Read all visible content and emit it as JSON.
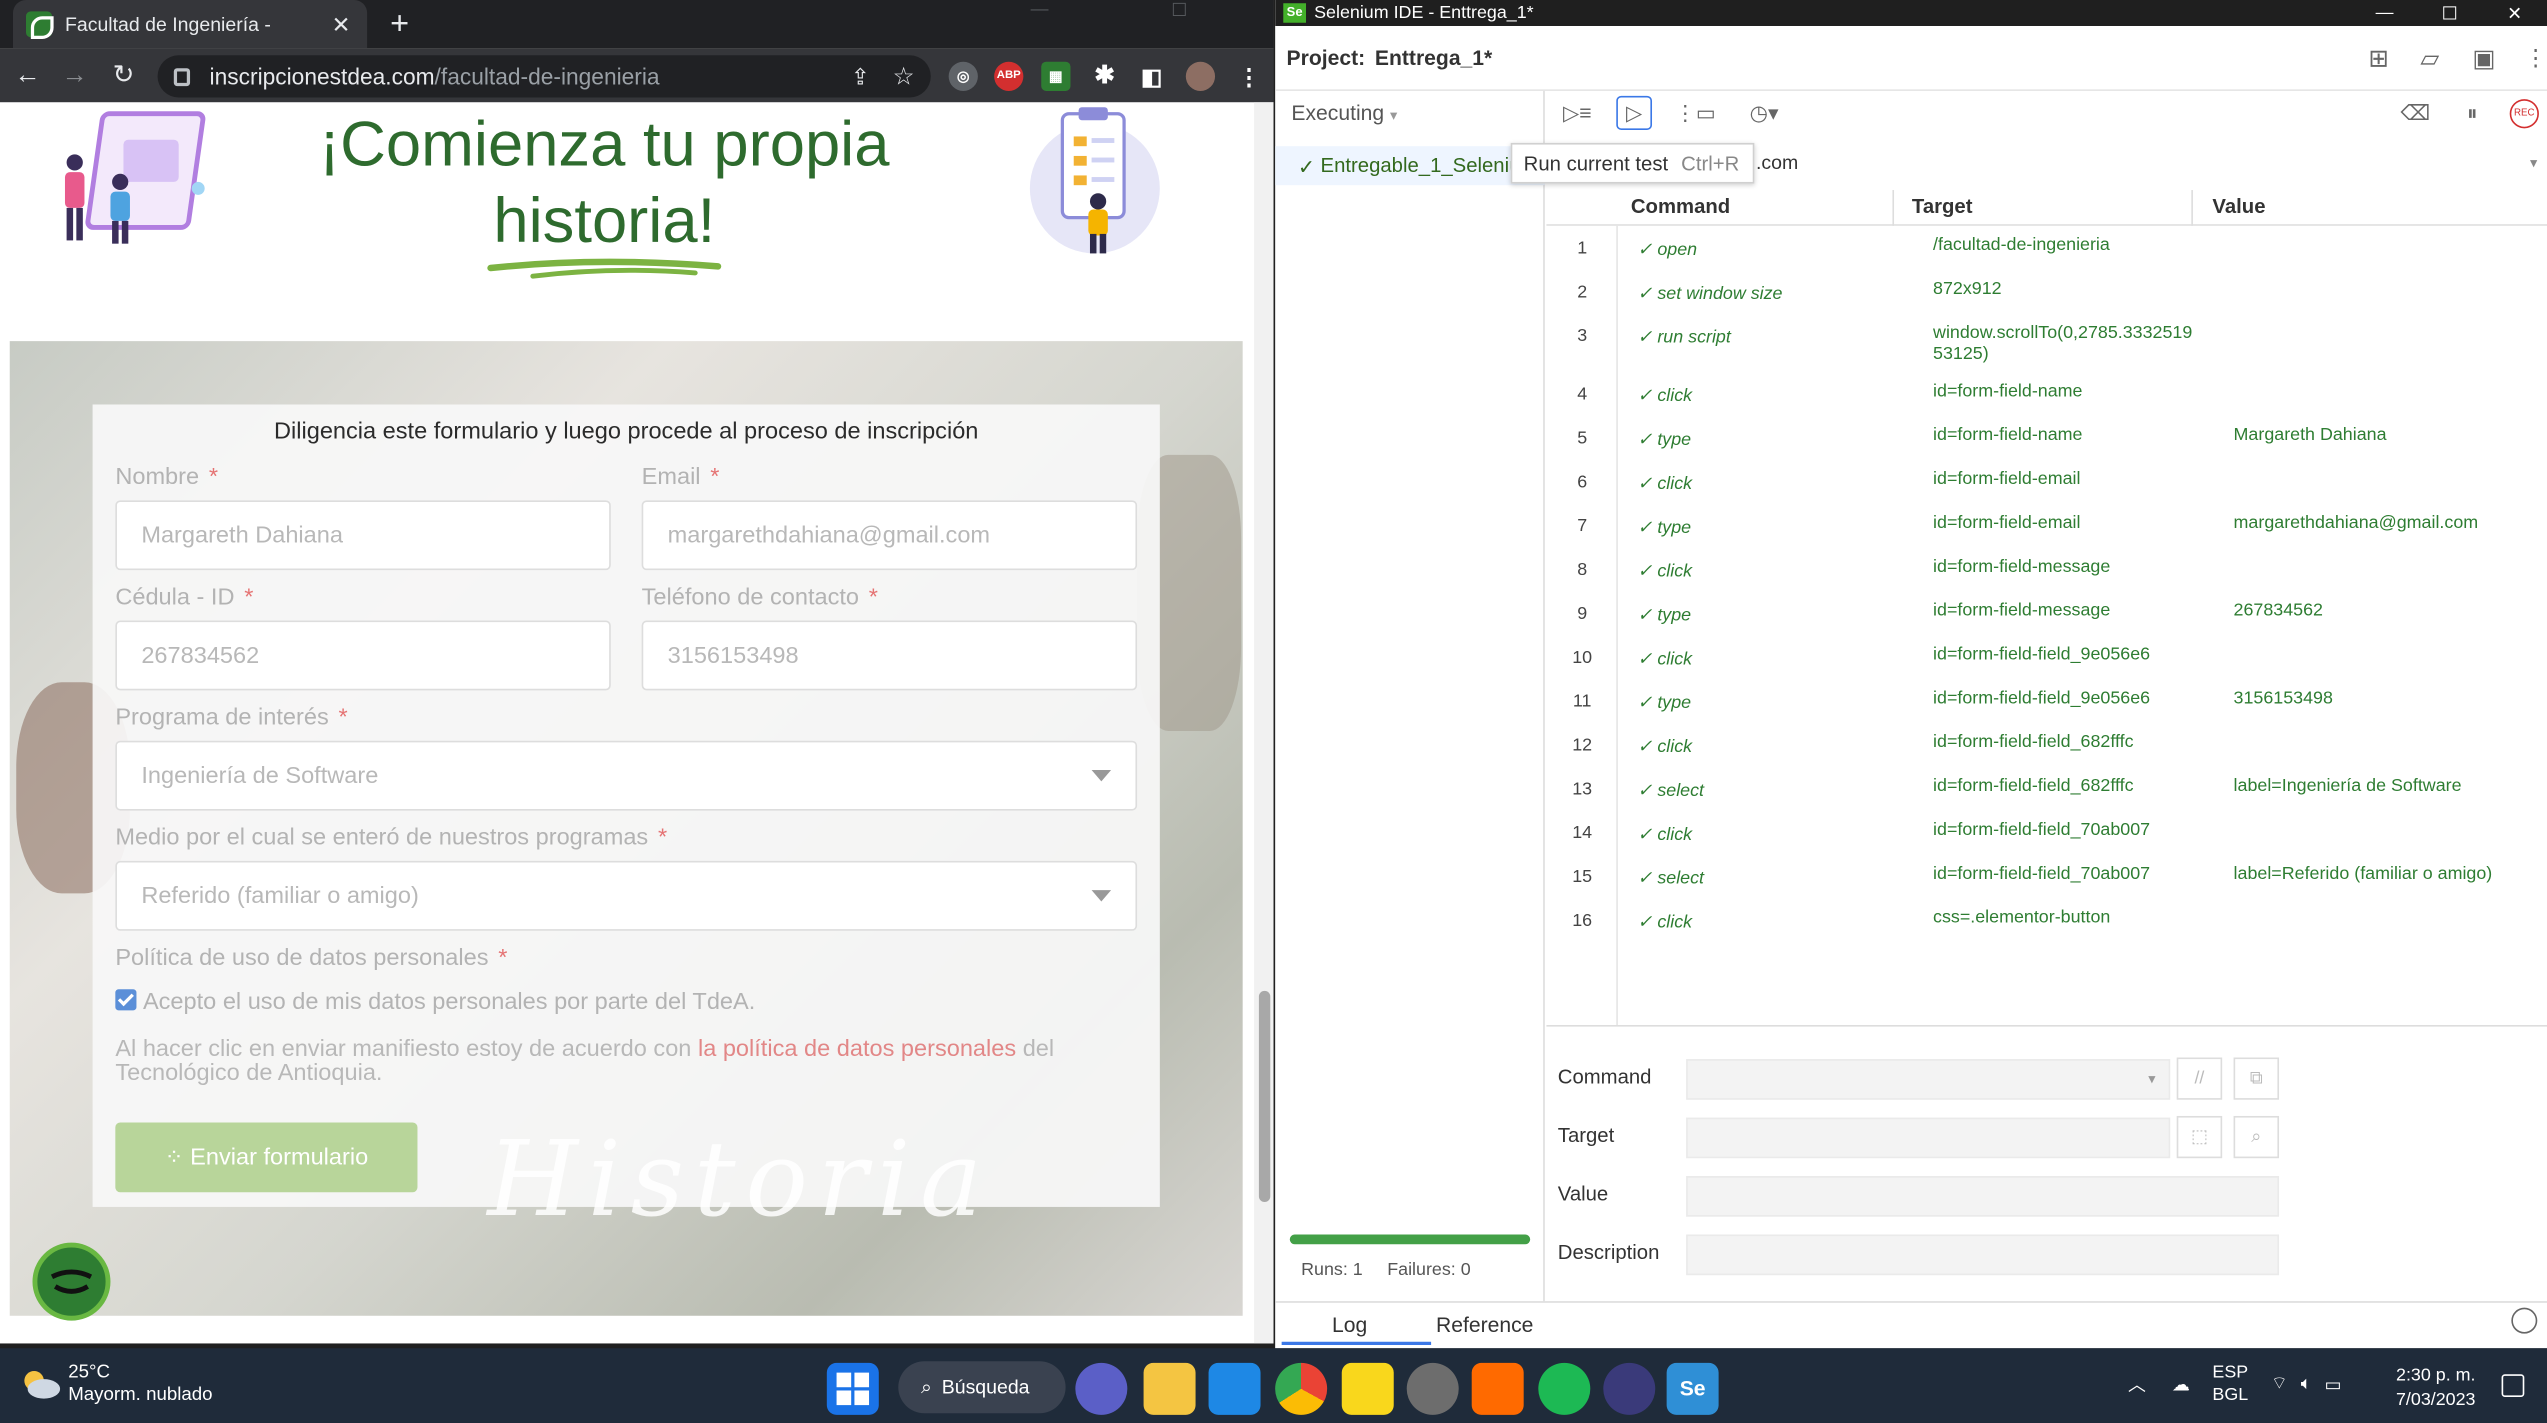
{
  "browser": {
    "tab_title": "Facultad de Ingeniería -",
    "url_host": "inscripcionestdea.com",
    "url_path": "/facultad-de-ingenieria"
  },
  "page": {
    "hero_line1": "¡Comienza tu propia",
    "hero_line2": "historia!",
    "form_intro": "Diligencia este formulario y luego procede al proceso de inscripción",
    "fields": {
      "nombre_label": "Nombre",
      "nombre_value": "Margareth Dahiana",
      "email_label": "Email",
      "email_value": "margarethdahiana@gmail.com",
      "cedula_label": "Cédula - ID",
      "cedula_value": "267834562",
      "telefono_label": "Teléfono de contacto",
      "telefono_value": "3156153498",
      "programa_label": "Programa de interés",
      "programa_value": "Ingeniería de Software",
      "medio_label": "Medio por el cual se enteró de nuestros programas",
      "medio_value": "Referido (familiar o amigo)",
      "politica_label": "Política de uso de datos personales",
      "checkbox_label": "Acepto el uso de mis datos personales por parte del TdeA.",
      "required_mark": "*"
    },
    "policy_text_pre": "Al hacer clic en enviar manifiesto estoy de acuerdo con ",
    "policy_link": "la política de datos personales",
    "policy_text_post": " del Tecnológico de Antioquia.",
    "submit_label": "Enviar formulario",
    "watermark": "Historia"
  },
  "ide": {
    "window_title": "Selenium IDE - Enttrega_1*",
    "project_label": "Project:",
    "project_name": "Enttrega_1*",
    "executing_label": "Executing",
    "test_name": "Entregable_1_Selenium",
    "tooltip_label": "Run current test",
    "tooltip_shortcut": "Ctrl+R",
    "url_value": ".com",
    "col_command": "Command",
    "col_target": "Target",
    "col_value": "Value",
    "commands": [
      {
        "num": "1",
        "cmd": "open",
        "target": "/facultad-de-ingenieria",
        "value": ""
      },
      {
        "num": "2",
        "cmd": "set window size",
        "target": "872x912",
        "value": ""
      },
      {
        "num": "3",
        "cmd": "run script",
        "target": "window.scrollTo(0,2785.3332519 53125)",
        "value": ""
      },
      {
        "num": "4",
        "cmd": "click",
        "target": "id=form-field-name",
        "value": ""
      },
      {
        "num": "5",
        "cmd": "type",
        "target": "id=form-field-name",
        "value": "Margareth Dahiana"
      },
      {
        "num": "6",
        "cmd": "click",
        "target": "id=form-field-email",
        "value": ""
      },
      {
        "num": "7",
        "cmd": "type",
        "target": "id=form-field-email",
        "value": "margarethdahiana@gmail.com"
      },
      {
        "num": "8",
        "cmd": "click",
        "target": "id=form-field-message",
        "value": ""
      },
      {
        "num": "9",
        "cmd": "type",
        "target": "id=form-field-message",
        "value": "267834562"
      },
      {
        "num": "10",
        "cmd": "click",
        "target": "id=form-field-field_9e056e6",
        "value": ""
      },
      {
        "num": "11",
        "cmd": "type",
        "target": "id=form-field-field_9e056e6",
        "value": "3156153498"
      },
      {
        "num": "12",
        "cmd": "click",
        "target": "id=form-field-field_682fffc",
        "value": ""
      },
      {
        "num": "13",
        "cmd": "select",
        "target": "id=form-field-field_682fffc",
        "value": "label=Ingeniería de Software"
      },
      {
        "num": "14",
        "cmd": "click",
        "target": "id=form-field-field_70ab007",
        "value": ""
      },
      {
        "num": "15",
        "cmd": "select",
        "target": "id=form-field-field_70ab007",
        "value": "label=Referido (familiar o amigo)"
      },
      {
        "num": "16",
        "cmd": "click",
        "target": "css=.elementor-button",
        "value": ""
      }
    ],
    "editor": {
      "command_label": "Command",
      "target_label": "Target",
      "value_label": "Value",
      "description_label": "Description"
    },
    "runs_label": "Runs: 1",
    "failures_label": "Failures: 0",
    "progress_fraction": 1.0,
    "log_tab": "Log",
    "reference_tab": "Reference"
  },
  "taskbar": {
    "temperature": "25°C",
    "weather": "Mayorm. nublado",
    "search_label": "Búsqueda",
    "lang": "ESP",
    "layout": "BGL",
    "time": "2:30 p. m.",
    "date": "7/03/2023"
  }
}
